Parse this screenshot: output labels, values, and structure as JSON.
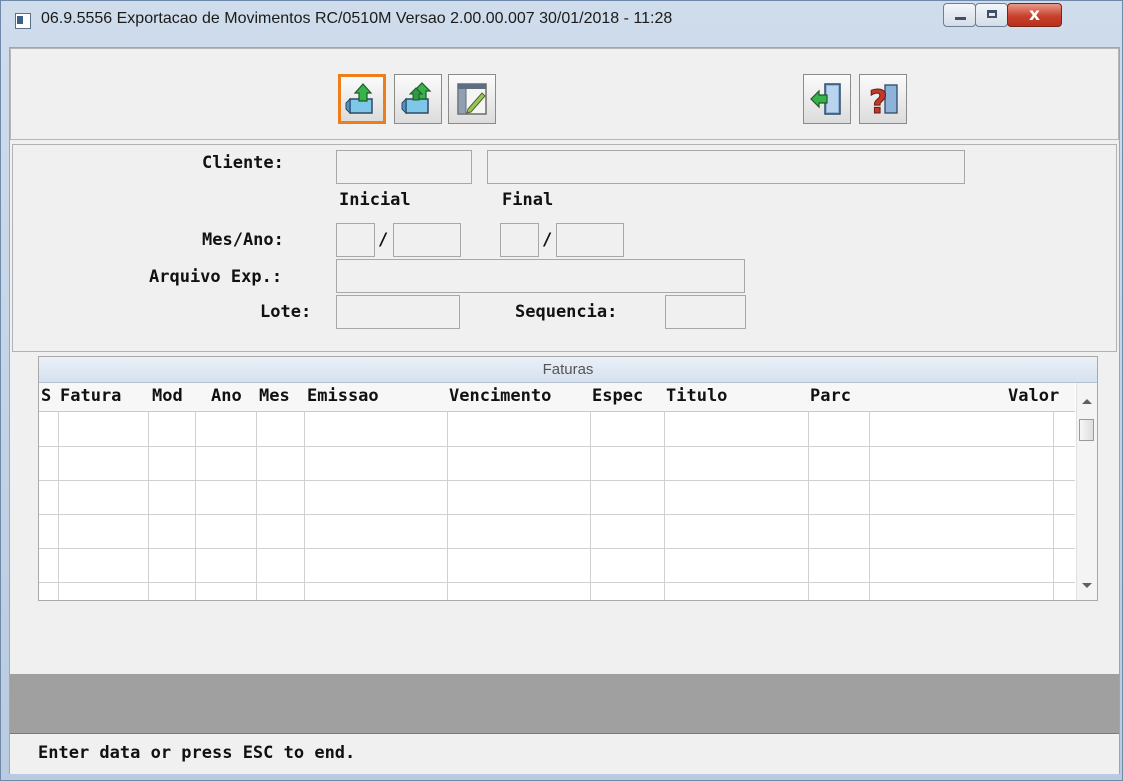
{
  "window": {
    "title": "06.9.5556  Exportacao  de Movimentos RC/0510M Versao 2.00.00.007 30/01/2018 - 11:28",
    "buttons": {
      "minimize": "",
      "maximize": "",
      "close": "x"
    }
  },
  "toolbar": {
    "buttons": [
      {
        "name": "export-icon",
        "active": true
      },
      {
        "name": "export-all-icon",
        "active": false
      },
      {
        "name": "edit-icon",
        "active": false
      },
      {
        "name": "exit-icon",
        "active": false
      },
      {
        "name": "help-icon",
        "active": false
      }
    ]
  },
  "form": {
    "cliente_label": "Cliente:",
    "inicial_label": "Inicial",
    "final_label": "Final",
    "mesano_label": "Mes/Ano:",
    "slash": "/",
    "arquivo_label": "Arquivo Exp.:",
    "lote_label": "Lote:",
    "sequencia_label": "Sequencia:",
    "cliente_code": "",
    "cliente_name": "",
    "mes_inicial": "",
    "ano_inicial": "",
    "mes_final": "",
    "ano_final": "",
    "arquivo": "",
    "lote": "",
    "sequencia": ""
  },
  "grid": {
    "caption": "Faturas",
    "columns": [
      "S",
      "Fatura",
      "Mod",
      "Ano",
      "Mes",
      "Emissao",
      "Vencimento",
      "Espec",
      "Titulo",
      "Parc",
      "Valor"
    ],
    "rows": []
  },
  "status": {
    "message": "Enter data or press ESC to end."
  }
}
